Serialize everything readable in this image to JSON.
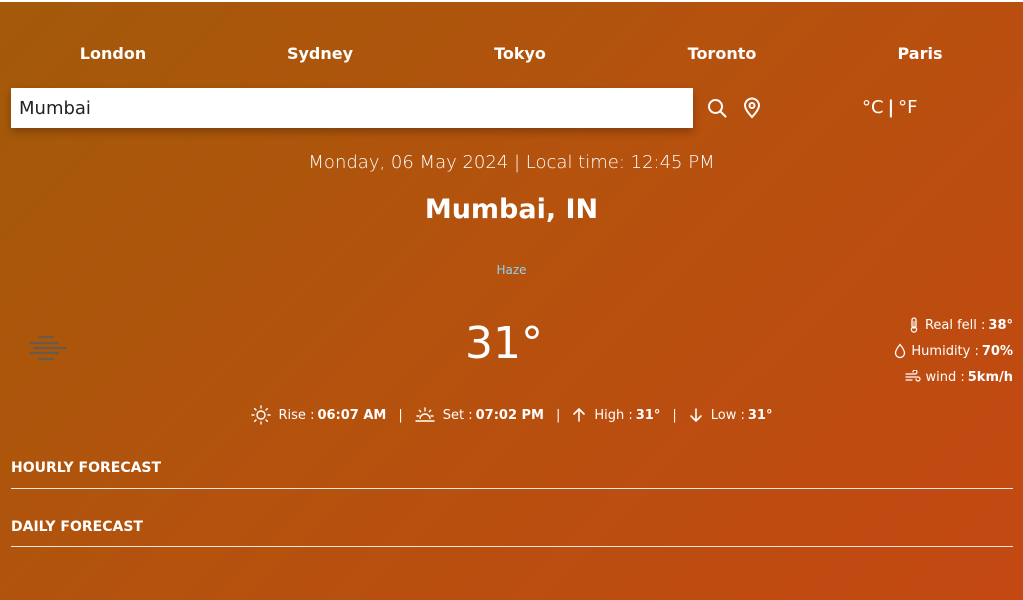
{
  "cities": [
    "London",
    "Sydney",
    "Tokyo",
    "Toronto",
    "Paris"
  ],
  "search": {
    "value": "Mumbai"
  },
  "icons": {
    "search": "search-icon",
    "location": "location-pin-icon"
  },
  "units": {
    "celsius": "°C",
    "separator": "|",
    "fahrenheit": "°F"
  },
  "datetime": "Monday, 06 May 2024 | Local time: 12:45 PM",
  "location": "Mumbai, IN",
  "condition": "Haze",
  "temperature": "31°",
  "details": {
    "real_feel_label": "Real fell :",
    "real_feel_value": "38°",
    "humidity_label": "Humidity :",
    "humidity_value": "70%",
    "wind_label": "wind :",
    "wind_value": "5km/h"
  },
  "sun": {
    "rise_label": "Rise :",
    "rise_value": "06:07 AM",
    "set_label": "Set :",
    "set_value": "07:02 PM",
    "high_label": "High :",
    "high_value": "31°",
    "low_label": "Low :",
    "low_value": "31°",
    "separator": "|"
  },
  "sections": {
    "hourly": "HOURLY FORECAST",
    "daily": "DAILY FORECAST"
  },
  "colors": {
    "condition": "#8fd3ee",
    "background_start": "#a35a09",
    "background_end": "#c44812"
  }
}
